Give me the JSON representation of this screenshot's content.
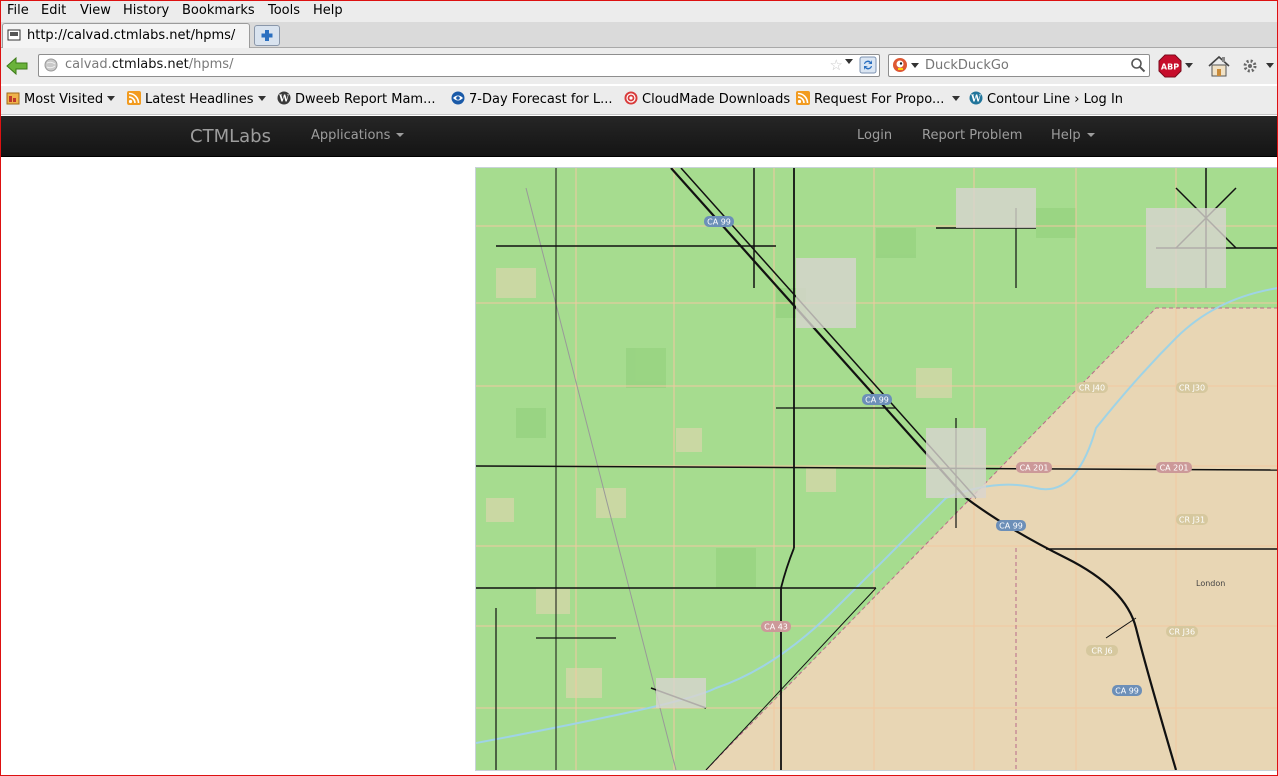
{
  "menubar": {
    "items": [
      {
        "label": "File"
      },
      {
        "label": "Edit"
      },
      {
        "label": "View"
      },
      {
        "label": "History"
      },
      {
        "label": "Bookmarks"
      },
      {
        "label": "Tools"
      },
      {
        "label": "Help"
      }
    ]
  },
  "tab": {
    "title": "http://calvad.ctmlabs.net/hpms/"
  },
  "navbar": {
    "url_prefix": "calvad.",
    "url_domain": "ctmlabs.net",
    "url_path": "/hpms/",
    "search_placeholder": "DuckDuckGo"
  },
  "bookmarks": [
    {
      "label": "Most Visited",
      "icon": "most-visited-icon",
      "dropdown": true
    },
    {
      "label": "Latest Headlines",
      "icon": "rss-icon",
      "dropdown": true
    },
    {
      "label": "Dweeb Report Mam...",
      "icon": "wordpress-icon",
      "dropdown": false
    },
    {
      "label": "7-Day Forecast for L...",
      "icon": "noaa-icon",
      "dropdown": false
    },
    {
      "label": "CloudMade Downloads",
      "icon": "cloudmade-icon",
      "dropdown": false
    },
    {
      "label": "Request For Propo...",
      "icon": "rss-icon",
      "dropdown": true
    },
    {
      "label": "Contour Line › Log In",
      "icon": "wordpress-icon",
      "dropdown": false
    }
  ],
  "site": {
    "brand": "CTMLabs",
    "applications_label": "Applications",
    "login_label": "Login",
    "report_problem_label": "Report Problem",
    "help_label": "Help"
  },
  "map": {
    "shields": [
      "CA 99",
      "CA 99",
      "CA 99",
      "CA 99",
      "CA 43",
      "CA 201",
      "CA 201",
      "CR J40",
      "CR J31",
      "CR J36",
      "CR J6",
      "CR J30"
    ],
    "places": [
      "London"
    ],
    "colors": {
      "farmland": "#a6dc8f",
      "desert": "#e8d6b4",
      "roads": "#111111",
      "river": "#9fd3e6",
      "minor_roads": "#f2c8a0"
    }
  }
}
